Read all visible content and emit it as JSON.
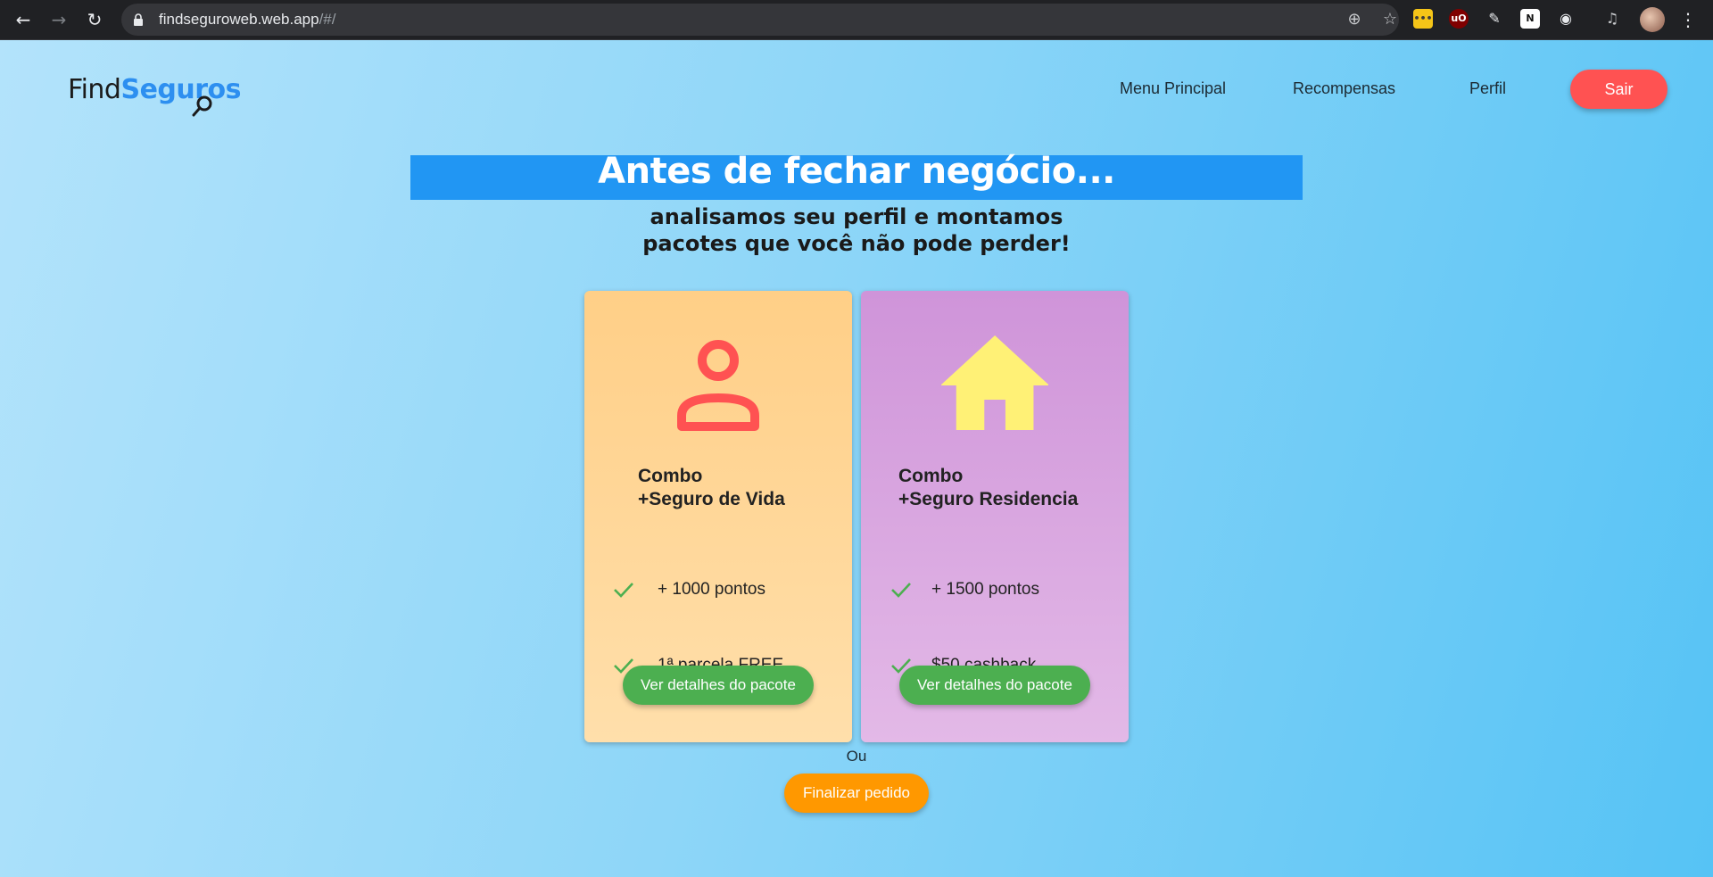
{
  "browser": {
    "url_host": "findseguroweb.web.app",
    "url_path": "/#/",
    "back_icon": "arrow-left-icon",
    "forward_icon": "arrow-right-icon",
    "reload_icon": "reload-icon",
    "extensions": [
      "ublock-icon",
      "notion-icon"
    ]
  },
  "header": {
    "logo_find": "Find",
    "logo_seguros": "Seguros",
    "nav": [
      "Menu Principal",
      "Recompensas",
      "Perfil"
    ],
    "logout_label": "Sair"
  },
  "hero": {
    "title": "Antes de fechar negócio...",
    "subtitle_line1": "analisamos seu perfil e montamos",
    "subtitle_line2": "pacotes que você não pode perder!"
  },
  "packages": [
    {
      "title_line1": "Combo",
      "title_line2": "+Seguro de Vida",
      "icon": "person-icon",
      "features": [
        "+ 1000 pontos",
        "1ª parcela FREE"
      ],
      "button": "Ver detalhes do pacote"
    },
    {
      "title_line1": "Combo",
      "title_line2": "+Seguro Residencia",
      "icon": "house-icon",
      "features": [
        "+ 1500 pontos",
        "$50 cashback"
      ],
      "button": "Ver detalhes do pacote"
    }
  ],
  "footer": {
    "or_label": "Ou",
    "finalize_label": "Finalizar pedido"
  },
  "colors": {
    "accent_blue": "#2196f3",
    "logout_red": "#ff5252",
    "success_green": "#4caf50",
    "finalize_orange": "#ff9800"
  }
}
